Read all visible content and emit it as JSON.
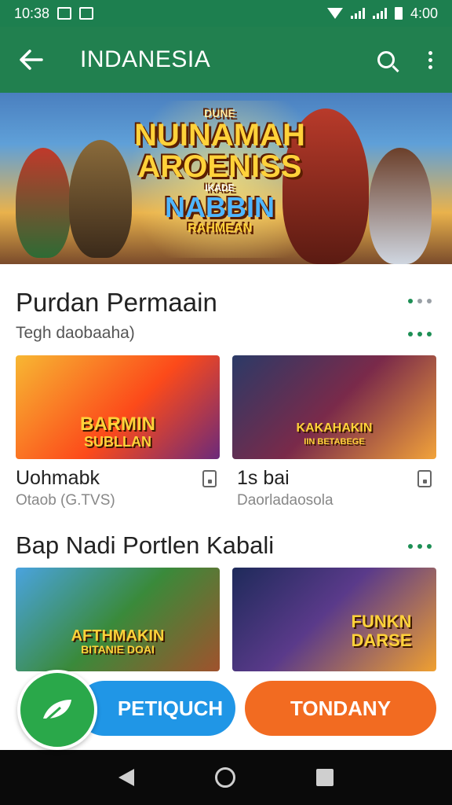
{
  "status_bar": {
    "time": "10:38",
    "battery_time": "4:00"
  },
  "app_bar": {
    "title": "INDANESIA",
    "back_icon": "arrow-left-icon",
    "search_icon": "search-icon",
    "more_icon": "more-vert-icon"
  },
  "hero": {
    "lines": [
      "DUNE",
      "NUINAMAH",
      "AROENISS",
      "IKADE",
      "NABBIN",
      "RAHMEAN"
    ]
  },
  "section1": {
    "title": "Purdan Permaain",
    "subtitle": "Tegh daobaaha)",
    "cards": [
      {
        "image_text_1": "BARMIN",
        "image_text_2": "SUBLLAN",
        "name": "Uohmabk",
        "meta": "Otaob (G.TVS)"
      },
      {
        "image_text_1": "KAKAHAKIN",
        "image_text_2": "IIN BETABEGE",
        "name": "1s bai",
        "meta": "Daorladaosola"
      }
    ]
  },
  "section2": {
    "title": "Bap Nadi Portlen Kabali",
    "cards": [
      {
        "image_text_1": "AFTHMAKIN",
        "image_text_2": "BITANIE DOAI"
      },
      {
        "image_text_1": "FUNKN",
        "image_text_2": "DARSE"
      }
    ]
  },
  "actions": {
    "blue_label": "PETIQUCH",
    "orange_label": "TONDANY"
  },
  "colors": {
    "primary": "#21804f",
    "blue": "#2096e6",
    "orange": "#f26b21",
    "fab": "#2aa84a"
  }
}
